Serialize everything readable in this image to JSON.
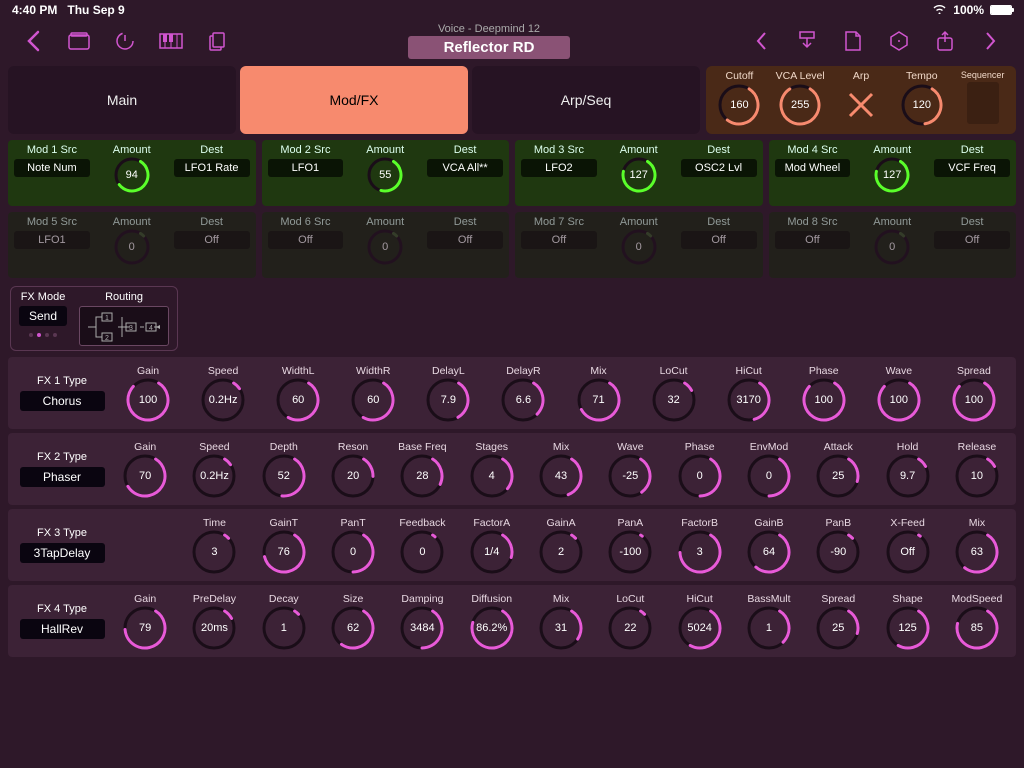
{
  "status": {
    "time": "4:40 PM",
    "date": "Thu Sep 9",
    "battery": "100%"
  },
  "header": {
    "voice_label": "Voice - Deepmind 12",
    "patch": "Reflector RD"
  },
  "tabs": [
    "Main",
    "Mod/FX",
    "Arp/Seq"
  ],
  "active_tab": 1,
  "perf": [
    {
      "label": "Cutoff",
      "value": "160",
      "arc": 0.63,
      "color": "#f78a6e"
    },
    {
      "label": "VCA Level",
      "value": "255",
      "arc": 1.0,
      "color": "#f78a6e"
    },
    {
      "label": "Arp",
      "value": "",
      "x": true
    },
    {
      "label": "Tempo",
      "value": "120",
      "arc": 0.47,
      "color": "#f78a6e"
    },
    {
      "label": "Sequencer",
      "seq": true
    }
  ],
  "mods": [
    {
      "src_h": "Mod 1 Src",
      "src": "Note Num",
      "amt": "94",
      "arc": 0.68,
      "dest": "LFO1 Rate",
      "active": true
    },
    {
      "src_h": "Mod 2 Src",
      "src": "LFO1",
      "amt": "55",
      "arc": 0.55,
      "dest": "VCA All**",
      "active": true
    },
    {
      "src_h": "Mod 3 Src",
      "src": "LFO2",
      "amt": "127",
      "arc": 0.85,
      "dest": "OSC2 Lvl",
      "active": true
    },
    {
      "src_h": "Mod 4 Src",
      "src": "Mod Wheel",
      "amt": "127",
      "arc": 0.85,
      "dest": "VCF Freq",
      "active": true
    },
    {
      "src_h": "Mod 5 Src",
      "src": "LFO1",
      "amt": "0",
      "arc": 0.05,
      "dest": "Off",
      "active": false
    },
    {
      "src_h": "Mod 6 Src",
      "src": "Off",
      "amt": "0",
      "arc": 0.05,
      "dest": "Off",
      "active": false
    },
    {
      "src_h": "Mod 7 Src",
      "src": "Off",
      "amt": "0",
      "arc": 0.05,
      "dest": "Off",
      "active": false
    },
    {
      "src_h": "Mod 8 Src",
      "src": "Off",
      "amt": "0",
      "arc": 0.05,
      "dest": "Off",
      "active": false
    }
  ],
  "fx_mode": {
    "mode_h": "FX Mode",
    "mode": "Send",
    "routing_h": "Routing"
  },
  "fx": [
    {
      "type_h": "FX 1 Type",
      "type": "Chorus",
      "params": [
        {
          "h": "Gain",
          "v": "100",
          "a": 0.95
        },
        {
          "h": "Speed",
          "v": "0.2Hz",
          "a": 0.08
        },
        {
          "h": "WidthL",
          "v": "60",
          "a": 0.6
        },
        {
          "h": "WidthR",
          "v": "60",
          "a": 0.6
        },
        {
          "h": "DelayL",
          "v": "7.9",
          "a": 0.4
        },
        {
          "h": "DelayR",
          "v": "6.6",
          "a": 0.35
        },
        {
          "h": "Mix",
          "v": "71",
          "a": 0.71
        },
        {
          "h": "LoCut",
          "v": "32",
          "a": 0.1
        },
        {
          "h": "HiCut",
          "v": "3170",
          "a": 0.45
        },
        {
          "h": "Phase",
          "v": "100",
          "a": 0.95
        },
        {
          "h": "Wave",
          "v": "100",
          "a": 0.95
        },
        {
          "h": "Spread",
          "v": "100",
          "a": 0.95
        }
      ]
    },
    {
      "type_h": "FX 2 Type",
      "type": "Phaser",
      "params": [
        {
          "h": "Gain",
          "v": "70",
          "a": 0.7
        },
        {
          "h": "Speed",
          "v": "0.2Hz",
          "a": 0.08
        },
        {
          "h": "Depth",
          "v": "52",
          "a": 0.52
        },
        {
          "h": "Reson",
          "v": "20",
          "a": 0.2
        },
        {
          "h": "Base Freq",
          "v": "28",
          "a": 0.28
        },
        {
          "h": "Stages",
          "v": "4",
          "a": 0.33
        },
        {
          "h": "Mix",
          "v": "43",
          "a": 0.43
        },
        {
          "h": "Wave",
          "v": "-25",
          "a": 0.38
        },
        {
          "h": "Phase",
          "v": "0",
          "a": 0.5
        },
        {
          "h": "EnvMod",
          "v": "0",
          "a": 0.5
        },
        {
          "h": "Attack",
          "v": "25",
          "a": 0.25
        },
        {
          "h": "Hold",
          "v": "9.7",
          "a": 0.1
        },
        {
          "h": "Release",
          "v": "10",
          "a": 0.1
        }
      ]
    },
    {
      "type_h": "FX 3 Type",
      "type": "3TapDelay",
      "params": [
        {
          "h": "",
          "v": "",
          "a": 0
        },
        {
          "h": "Time",
          "v": "3",
          "a": 0.05
        },
        {
          "h": "GainT",
          "v": "76",
          "a": 0.76
        },
        {
          "h": "PanT",
          "v": "0",
          "a": 0.5
        },
        {
          "h": "Feedback",
          "v": "0",
          "a": 0.03
        },
        {
          "h": "FactorA",
          "v": "1/4",
          "a": 0.25
        },
        {
          "h": "GainA",
          "v": "2",
          "a": 0.05
        },
        {
          "h": "PanA",
          "v": "-100",
          "a": 0.02
        },
        {
          "h": "FactorB",
          "v": "3",
          "a": 0.8
        },
        {
          "h": "GainB",
          "v": "64",
          "a": 0.64
        },
        {
          "h": "PanB",
          "v": "-90",
          "a": 0.05
        },
        {
          "h": "X-Feed",
          "v": "Off",
          "a": 0.02
        },
        {
          "h": "Mix",
          "v": "63",
          "a": 0.63
        }
      ]
    },
    {
      "type_h": "FX 4 Type",
      "type": "HallRev",
      "params": [
        {
          "h": "Gain",
          "v": "79",
          "a": 0.79
        },
        {
          "h": "PreDelay",
          "v": "20ms",
          "a": 0.1
        },
        {
          "h": "Decay",
          "v": "1",
          "a": 0.05
        },
        {
          "h": "Size",
          "v": "62",
          "a": 0.62
        },
        {
          "h": "Damping",
          "v": "3484",
          "a": 0.5
        },
        {
          "h": "Diffusion",
          "v": "86.2%",
          "a": 0.86
        },
        {
          "h": "Mix",
          "v": "31",
          "a": 0.31
        },
        {
          "h": "LoCut",
          "v": "22",
          "a": 0.05
        },
        {
          "h": "HiCut",
          "v": "5024",
          "a": 0.6
        },
        {
          "h": "BassMult",
          "v": "1",
          "a": 0.35
        },
        {
          "h": "Spread",
          "v": "25",
          "a": 0.25
        },
        {
          "h": "Shape",
          "v": "125",
          "a": 0.6
        },
        {
          "h": "ModSpeed",
          "v": "85",
          "a": 0.85
        }
      ]
    }
  ],
  "labels": {
    "amount": "Amount",
    "dest": "Dest"
  }
}
